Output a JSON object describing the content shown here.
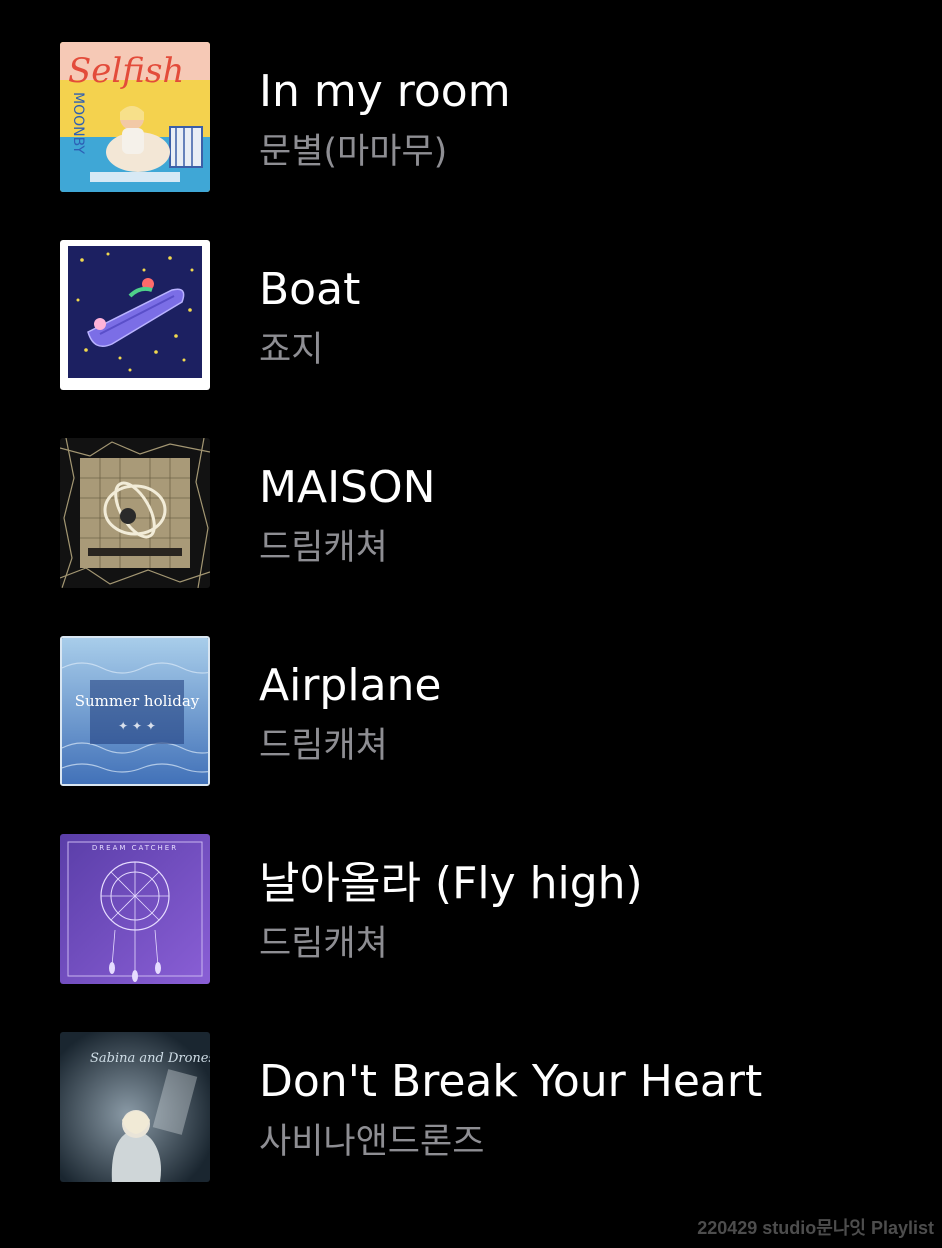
{
  "tracks": [
    {
      "title": "In my room",
      "artist": "문별(마마무)",
      "cover_icon": "album-cover-selfish",
      "cover_text": "Selfish"
    },
    {
      "title": "Boat",
      "artist": "죠지",
      "cover_icon": "album-cover-boat"
    },
    {
      "title": "MAISON",
      "artist": "드림캐쳐",
      "cover_icon": "album-cover-apocalypse"
    },
    {
      "title": "Airplane",
      "artist": "드림캐쳐",
      "cover_icon": "album-cover-summer-holiday",
      "cover_text": "Summer holiday"
    },
    {
      "title": "날아올라 (Fly high)",
      "artist": "드림캐쳐",
      "cover_icon": "album-cover-dreamcatcher-purple",
      "cover_text": "DREAM CATCHER"
    },
    {
      "title": "Don't Break Your Heart",
      "artist": "사비나앤드론즈",
      "cover_icon": "album-cover-sabina",
      "cover_text": "Sabina and Drones"
    }
  ],
  "watermark": "220429 studio문나잇 Playlist",
  "colors": {
    "background": "#000000",
    "title": "#ffffff",
    "artist": "#8e8e93",
    "watermark": "#4d4d4d"
  }
}
